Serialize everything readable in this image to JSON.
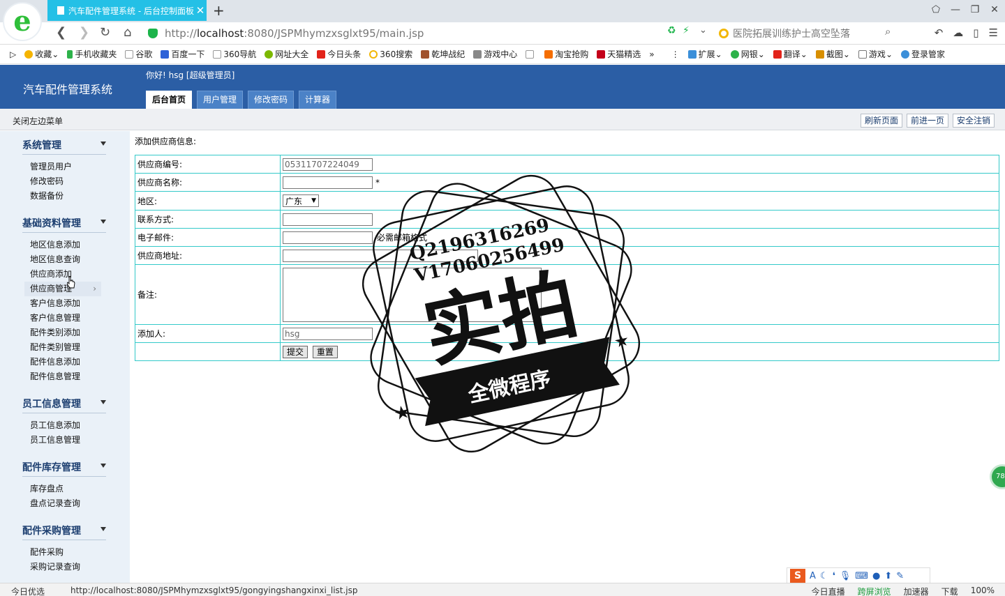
{
  "browser": {
    "tab_title": "汽车配件管理系统 - 后台控制面板",
    "url_prefix": "http://",
    "url_host": "localhost",
    "url_rest": ":8080/JSPMhymzxsglxt95/main.jsp",
    "search_placeholder": "医院拓展训练护士高空坠落",
    "bookmarks": [
      "收藏",
      "手机收藏夹",
      "谷歌",
      "百度一下",
      "360导航",
      "网址大全",
      "今日头条",
      "360搜索",
      "乾坤战纪",
      "游戏中心",
      "淘宝抢购",
      "天猫精选",
      "扩展",
      "网银",
      "翻译",
      "截图",
      "游戏",
      "登录管家"
    ]
  },
  "app": {
    "title": "汽车配件管理系统",
    "greeting": "你好! hsg [超级管理员]",
    "tabs": [
      "后台首页",
      "用户管理",
      "修改密码",
      "计算器"
    ],
    "close_left_menu": "关闭左边菜单",
    "sub_buttons": [
      "刷新页面",
      "前进一页",
      "安全注销"
    ]
  },
  "sidebar": {
    "sections": [
      {
        "title": "系统管理",
        "items": [
          "管理员用户",
          "修改密码",
          "数据备份"
        ]
      },
      {
        "title": "基础资料管理",
        "items": [
          "地区信息添加",
          "地区信息查询",
          "供应商添加",
          "供应商管理",
          "客户信息添加",
          "客户信息管理",
          "配件类别添加",
          "配件类别管理",
          "配件信息添加",
          "配件信息管理"
        ]
      },
      {
        "title": "员工信息管理",
        "items": [
          "员工信息添加",
          "员工信息管理"
        ]
      },
      {
        "title": "配件库存管理",
        "items": [
          "库存盘点",
          "盘点记录查询"
        ]
      },
      {
        "title": "配件采购管理",
        "items": [
          "配件采购",
          "采购记录查询"
        ]
      }
    ]
  },
  "form": {
    "title": "添加供应商信息:",
    "labels": [
      "供应商编号:",
      "供应商名称:",
      "地区:",
      "联系方式:",
      "电子邮件:",
      "供应商地址:",
      "备注:",
      "添加人:"
    ],
    "supplier_no": "05311707224049",
    "name_required_mark": "*",
    "region_value": "广东",
    "email_hint": "必需邮箱格式",
    "adder_value": "hsg",
    "submit_label": "提交",
    "reset_label": "重置"
  },
  "watermark": {
    "line1": "Q2196316269",
    "line2": "V17060256499",
    "big_text": "实拍",
    "banner": "全微程序"
  },
  "side_float_label": "78",
  "statusbar": {
    "left": "今日优选",
    "url": "http://localhost:8080/JSPMhymzxsglxt95/gongyingshangxinxi_list.jsp",
    "right_items": [
      "今日直播",
      "跨屏浏览",
      "加速器",
      "下载",
      "100%"
    ]
  }
}
